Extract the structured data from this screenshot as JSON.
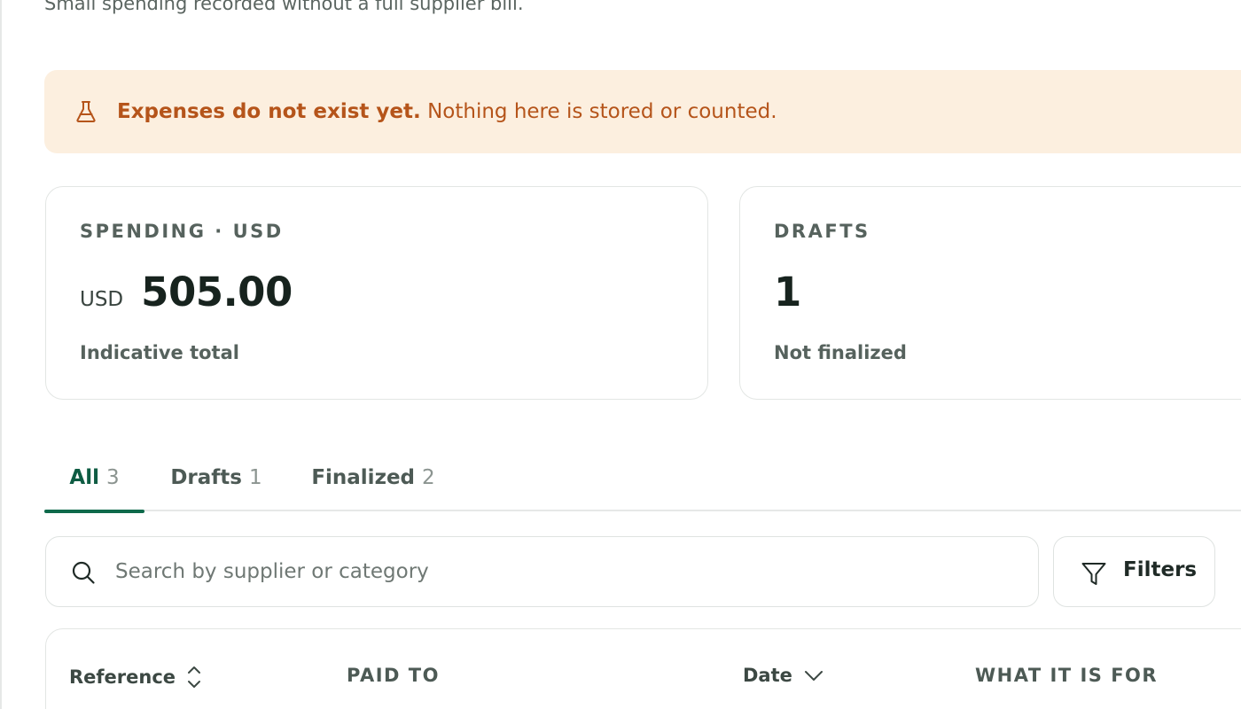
{
  "header": {
    "subtitle": "Small spending recorded without a full supplier bill."
  },
  "banner": {
    "icon": "flask-icon",
    "title": "Expenses do not exist yet.",
    "message": "Nothing here is stored or counted.",
    "color": "#b5541a",
    "background": "#fcefdf"
  },
  "cards": {
    "spending": {
      "label": "SPENDING · USD",
      "currency": "USD",
      "amount": "505.00",
      "caption": "Indicative total"
    },
    "drafts": {
      "label": "DRAFTS",
      "amount": "1",
      "caption": "Not finalized"
    }
  },
  "tabs": [
    {
      "name": "All",
      "count": "3",
      "active": true
    },
    {
      "name": "Drafts",
      "count": "1",
      "active": false
    },
    {
      "name": "Finalized",
      "count": "2",
      "active": false
    }
  ],
  "search": {
    "icon": "search-icon",
    "placeholder": "Search by supplier or category",
    "value": ""
  },
  "filters": {
    "icon": "filter-icon",
    "label": "Filters"
  },
  "table": {
    "columns": [
      {
        "label": "Reference",
        "sort": "sort-both-icon"
      },
      {
        "label": "PAID TO"
      },
      {
        "label": "Date",
        "sort": "chevron-down-icon"
      },
      {
        "label": "WHAT IT IS FOR"
      }
    ]
  },
  "colors": {
    "accent": "#0e6a4b",
    "border": "#e3e6e4",
    "muted": "#56625d"
  }
}
